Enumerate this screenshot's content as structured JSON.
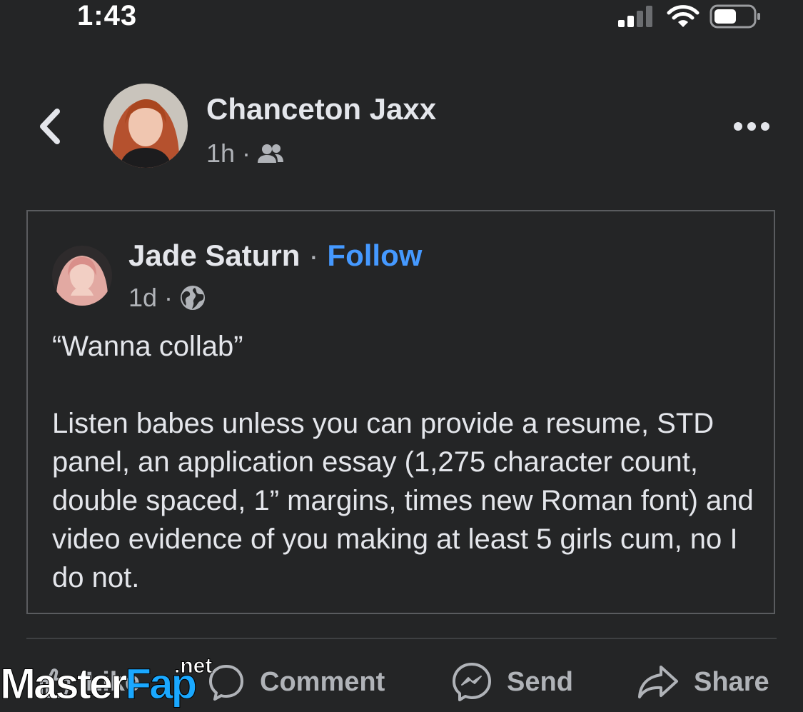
{
  "status_bar": {
    "time": "1:43"
  },
  "header": {
    "name": "Chanceton Jaxx",
    "time": "1h",
    "separator": "·",
    "audience_icon": "friends-icon"
  },
  "shared_post": {
    "author": "Jade Saturn",
    "separator": "·",
    "follow_label": "Follow",
    "time": "1d",
    "audience_icon": "globe-icon",
    "quote": "“Wanna collab”",
    "body": "Listen babes unless you can provide a resume, STD panel, an application essay (1,275 character count, double spaced, 1” margins, times new Roman font) and video evidence of you making at least 5 girls cum, no I do not."
  },
  "actions": {
    "like": "Like",
    "comment": "Comment",
    "send": "Send",
    "share": "Share"
  },
  "watermark": {
    "part1": "Master",
    "part2": "Fap",
    "suffix": ".net"
  },
  "colors": {
    "background": "#242526",
    "text_primary": "#e4e6eb",
    "text_secondary": "#b0b3b8",
    "link": "#4599ff",
    "card_border": "#5a5c5f"
  }
}
